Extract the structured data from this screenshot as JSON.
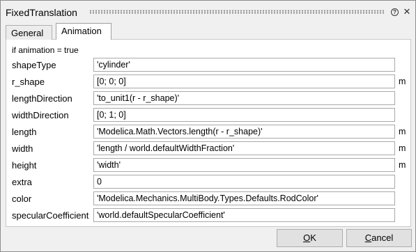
{
  "window": {
    "title": "FixedTranslation"
  },
  "tabs": [
    {
      "label": "General",
      "active": false
    },
    {
      "label": "Animation",
      "active": true
    }
  ],
  "condition": "if animation = true",
  "params": [
    {
      "name": "shapeType",
      "value": "'cylinder'",
      "unit": ""
    },
    {
      "name": "r_shape",
      "value": "[0; 0; 0]",
      "unit": "m"
    },
    {
      "name": "lengthDirection",
      "value": "'to_unit1(r - r_shape)'",
      "unit": ""
    },
    {
      "name": "widthDirection",
      "value": "[0; 1; 0]",
      "unit": ""
    },
    {
      "name": "length",
      "value": "'Modelica.Math.Vectors.length(r - r_shape)'",
      "unit": "m"
    },
    {
      "name": "width",
      "value": "'length / world.defaultWidthFraction'",
      "unit": "m"
    },
    {
      "name": "height",
      "value": "'width'",
      "unit": "m"
    },
    {
      "name": "extra",
      "value": "0",
      "unit": ""
    },
    {
      "name": "color",
      "value": "'Modelica.Mechanics.MultiBody.Types.Defaults.RodColor'",
      "unit": ""
    },
    {
      "name": "specularCoefficient",
      "value": "'world.defaultSpecularCoefficient'",
      "unit": ""
    }
  ],
  "buttons": {
    "ok_mnemonic": "O",
    "ok_rest": "K",
    "cancel_mnemonic": "C",
    "cancel_rest": "ancel"
  },
  "icons": {
    "help": "help-icon",
    "close": "close-icon"
  },
  "help_glyph": "?",
  "close_glyph": "✕"
}
